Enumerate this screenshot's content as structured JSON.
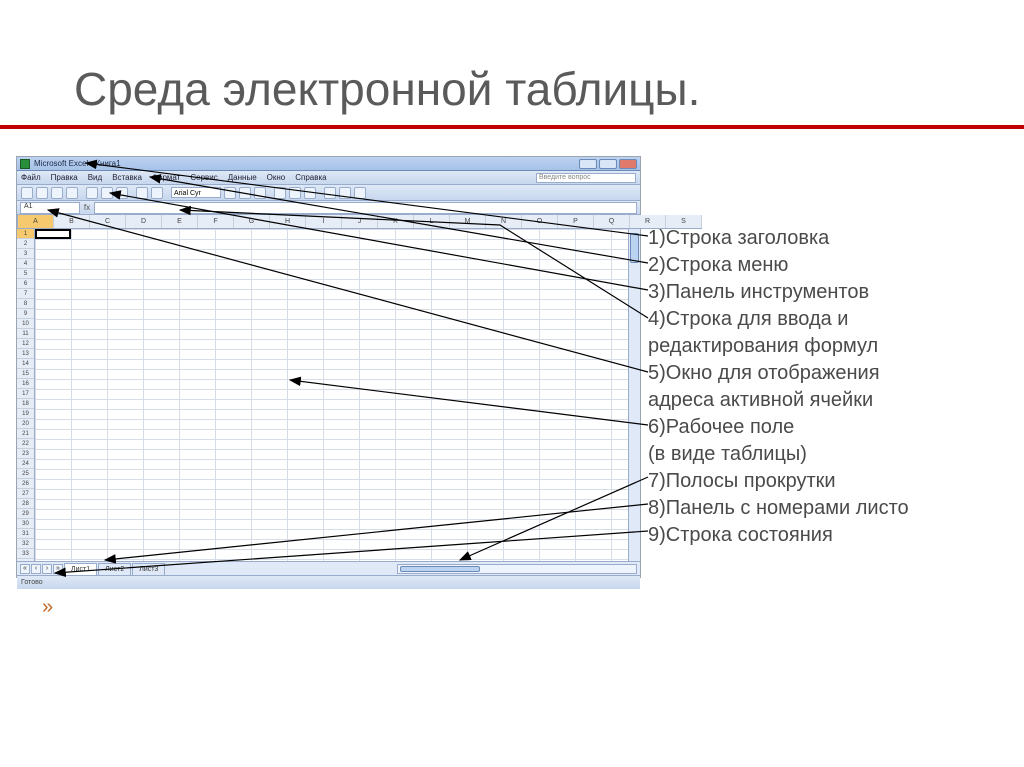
{
  "slide": {
    "title": "Среда электронной таблицы."
  },
  "excel": {
    "app_title": "Microsoft Excel - Книга1",
    "menu": [
      "Файл",
      "Правка",
      "Вид",
      "Вставка",
      "Формат",
      "Сервис",
      "Данные",
      "Окно",
      "Справка"
    ],
    "ask_placeholder": "Введите вопрос",
    "font_name": "Arial Cyr",
    "name_box": "A1",
    "columns": [
      "A",
      "B",
      "C",
      "D",
      "E",
      "F",
      "G",
      "H",
      "I",
      "J",
      "K",
      "L",
      "M",
      "N",
      "O",
      "P",
      "Q",
      "R",
      "S"
    ],
    "row_count": 33,
    "sheets": [
      "Лист1",
      "Лист2",
      "Лист3"
    ],
    "status": "Готово"
  },
  "annotations": [
    "1)Строка заголовка",
    "2)Строка меню",
    "3)Панель инструментов",
    "4)Строка для ввода и",
    "редактирования формул",
    "5)Окно для отображения",
    "адреса активной ячейки",
    "6)Рабочее поле",
    "(в виде таблицы)",
    "7)Полосы прокрутки",
    "8)Панель с номерами листо",
    "9)Строка состояния"
  ],
  "chevrons": "»"
}
